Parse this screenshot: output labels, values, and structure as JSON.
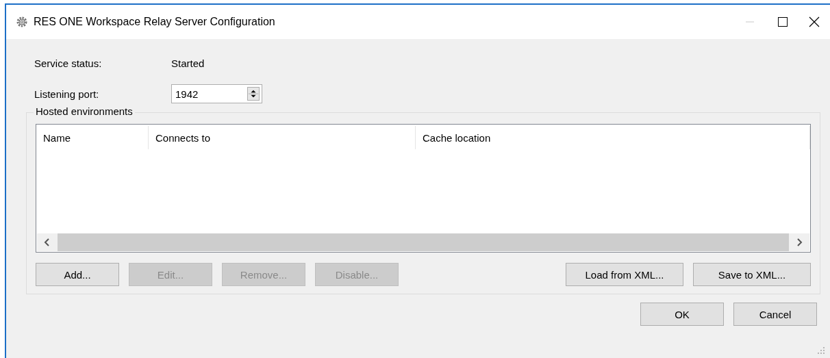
{
  "window": {
    "title": "RES ONE Workspace Relay Server Configuration",
    "minimize_disabled": true
  },
  "service_status": {
    "label": "Service status:",
    "value": "Started"
  },
  "listening_port": {
    "label": "Listening port:",
    "value": "1942"
  },
  "hosted_environments": {
    "title": "Hosted environments",
    "columns": [
      "Name",
      "Connects to",
      "Cache location"
    ],
    "list_buttons": [
      {
        "label": "Add...",
        "disabled": false
      },
      {
        "label": "Edit...",
        "disabled": true
      },
      {
        "label": "Remove...",
        "disabled": true
      },
      {
        "label": "Disable...",
        "disabled": true
      }
    ],
    "xml_buttons": [
      {
        "label": "Load from XML...",
        "disabled": false
      },
      {
        "label": "Save to XML...",
        "disabled": false
      }
    ]
  },
  "buttons": [
    {
      "label": "OK",
      "disabled": false
    },
    {
      "label": "Cancel",
      "disabled": false
    }
  ]
}
